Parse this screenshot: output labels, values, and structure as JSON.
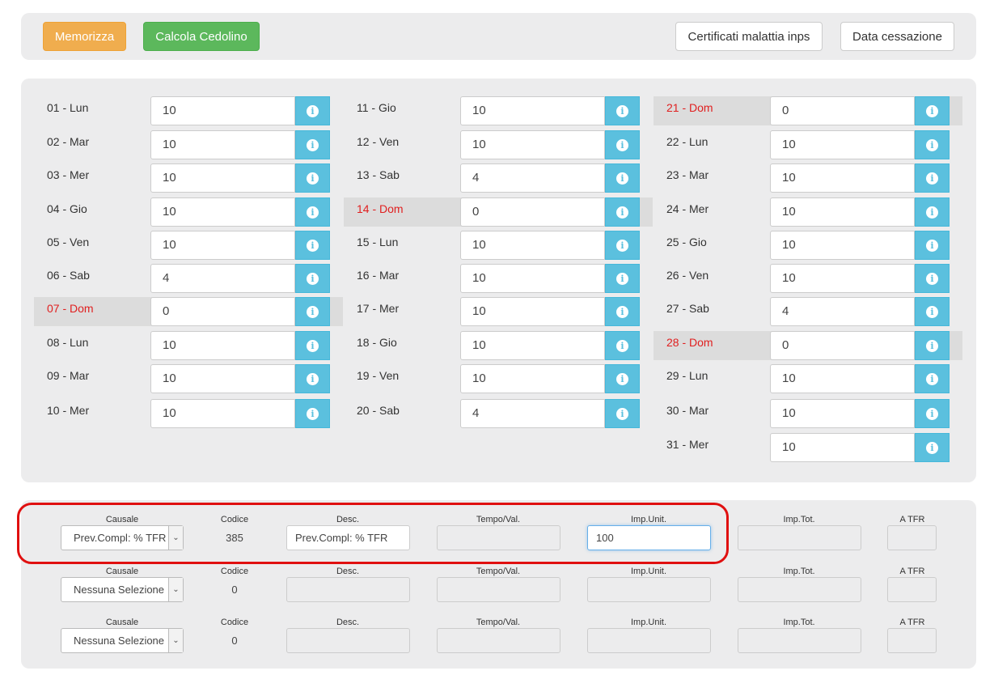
{
  "toolbar": {
    "save_label": "Memorizza",
    "calc_label": "Calcola Cedolino",
    "certificates_label": "Certificati malattia inps",
    "end_date_label": "Data cessazione"
  },
  "days": [
    {
      "label": "01 - Lun",
      "value": "10",
      "sunday": false
    },
    {
      "label": "02 - Mar",
      "value": "10",
      "sunday": false
    },
    {
      "label": "03 - Mer",
      "value": "10",
      "sunday": false
    },
    {
      "label": "04 - Gio",
      "value": "10",
      "sunday": false
    },
    {
      "label": "05 - Ven",
      "value": "10",
      "sunday": false
    },
    {
      "label": "06 - Sab",
      "value": "4",
      "sunday": false
    },
    {
      "label": "07 - Dom",
      "value": "0",
      "sunday": true
    },
    {
      "label": "08 - Lun",
      "value": "10",
      "sunday": false
    },
    {
      "label": "09 - Mar",
      "value": "10",
      "sunday": false
    },
    {
      "label": "10 - Mer",
      "value": "10",
      "sunday": false
    },
    {
      "label": "11 - Gio",
      "value": "10",
      "sunday": false
    },
    {
      "label": "12 - Ven",
      "value": "10",
      "sunday": false
    },
    {
      "label": "13 - Sab",
      "value": "4",
      "sunday": false
    },
    {
      "label": "14 - Dom",
      "value": "0",
      "sunday": true
    },
    {
      "label": "15 - Lun",
      "value": "10",
      "sunday": false
    },
    {
      "label": "16 - Mar",
      "value": "10",
      "sunday": false
    },
    {
      "label": "17 - Mer",
      "value": "10",
      "sunday": false
    },
    {
      "label": "18 - Gio",
      "value": "10",
      "sunday": false
    },
    {
      "label": "19 - Ven",
      "value": "10",
      "sunday": false
    },
    {
      "label": "20 - Sab",
      "value": "4",
      "sunday": false
    },
    {
      "label": "21 - Dom",
      "value": "0",
      "sunday": true
    },
    {
      "label": "22 - Lun",
      "value": "10",
      "sunday": false
    },
    {
      "label": "23 - Mar",
      "value": "10",
      "sunday": false
    },
    {
      "label": "24 - Mer",
      "value": "10",
      "sunday": false
    },
    {
      "label": "25 - Gio",
      "value": "10",
      "sunday": false
    },
    {
      "label": "26 - Ven",
      "value": "10",
      "sunday": false
    },
    {
      "label": "27 - Sab",
      "value": "4",
      "sunday": false
    },
    {
      "label": "28 - Dom",
      "value": "0",
      "sunday": true
    },
    {
      "label": "29 - Lun",
      "value": "10",
      "sunday": false
    },
    {
      "label": "30 - Mar",
      "value": "10",
      "sunday": false
    },
    {
      "label": "31 - Mer",
      "value": "10",
      "sunday": false
    }
  ],
  "entry_headers": {
    "causale": "Causale",
    "codice": "Codice",
    "desc": "Desc.",
    "tempo": "Tempo/Val.",
    "imp_unit": "Imp.Unit.",
    "imp_tot": "Imp.Tot.",
    "a_tfr": "A TFR"
  },
  "entries": [
    {
      "causale": "Prev.Compl: % TFR",
      "codice": "385",
      "desc": "Prev.Compl: % TFR",
      "tempo": "",
      "imp_unit": "100",
      "imp_tot": "",
      "a_tfr": ""
    },
    {
      "causale": "Nessuna Selezione",
      "codice": "0",
      "desc": "",
      "tempo": "",
      "imp_unit": "",
      "imp_tot": "",
      "a_tfr": ""
    },
    {
      "causale": "Nessuna Selezione",
      "codice": "0",
      "desc": "",
      "tempo": "",
      "imp_unit": "",
      "imp_tot": "",
      "a_tfr": ""
    }
  ],
  "colors": {
    "info": "#5bc0de",
    "warning": "#f0ad4e",
    "success": "#5cb85c",
    "sunday": "#e02020",
    "highlight": "#e01010"
  }
}
